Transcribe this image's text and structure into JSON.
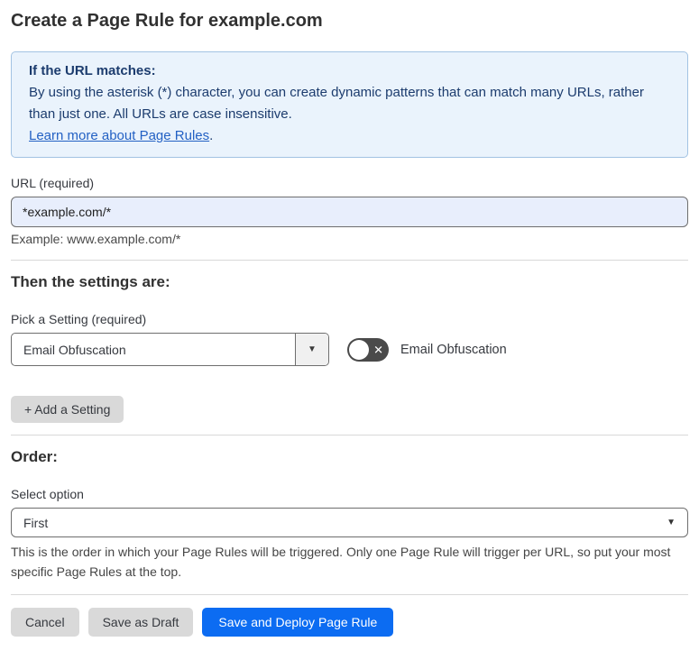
{
  "page": {
    "title": "Create a Page Rule for example.com"
  },
  "info_box": {
    "heading": "If the URL matches:",
    "body": "By using the asterisk (*) character, you can create dynamic patterns that can match many URLs, rather than just one. All URLs are case insensitive.",
    "link_label": "Learn more about Page Rules",
    "link_suffix": "."
  },
  "url_field": {
    "label": "URL (required)",
    "value": "*example.com/*",
    "hint": "Example: www.example.com/*"
  },
  "settings_section": {
    "heading": "Then the settings are:",
    "picker_label": "Pick a Setting (required)",
    "picker_value": "Email Obfuscation",
    "picker_arrow_icon": "▼",
    "toggle_label": "Email Obfuscation",
    "toggle_state": "off",
    "toggle_off_icon": "✕",
    "add_button_label": "+ Add a Setting"
  },
  "order_section": {
    "heading": "Order:",
    "select_label": "Select option",
    "select_value": "First",
    "select_arrow_icon": "▼",
    "description": "This is the order in which your Page Rules will be triggered. Only one Page Rule will trigger per URL, so put your most specific Page Rules at the top."
  },
  "footer": {
    "cancel_label": "Cancel",
    "save_draft_label": "Save as Draft",
    "save_deploy_label": "Save and Deploy Page Rule"
  },
  "colors": {
    "accent_blue": "#0c6cf2",
    "info_bg": "#eaf3fc",
    "info_border": "#a3c3e3",
    "info_text": "#1c3c6e",
    "link_blue": "#2361c4",
    "input_autofill_bg": "#e8eefc",
    "toggle_off_bg": "#4a4a4a",
    "button_gray": "#d9d9d9"
  }
}
